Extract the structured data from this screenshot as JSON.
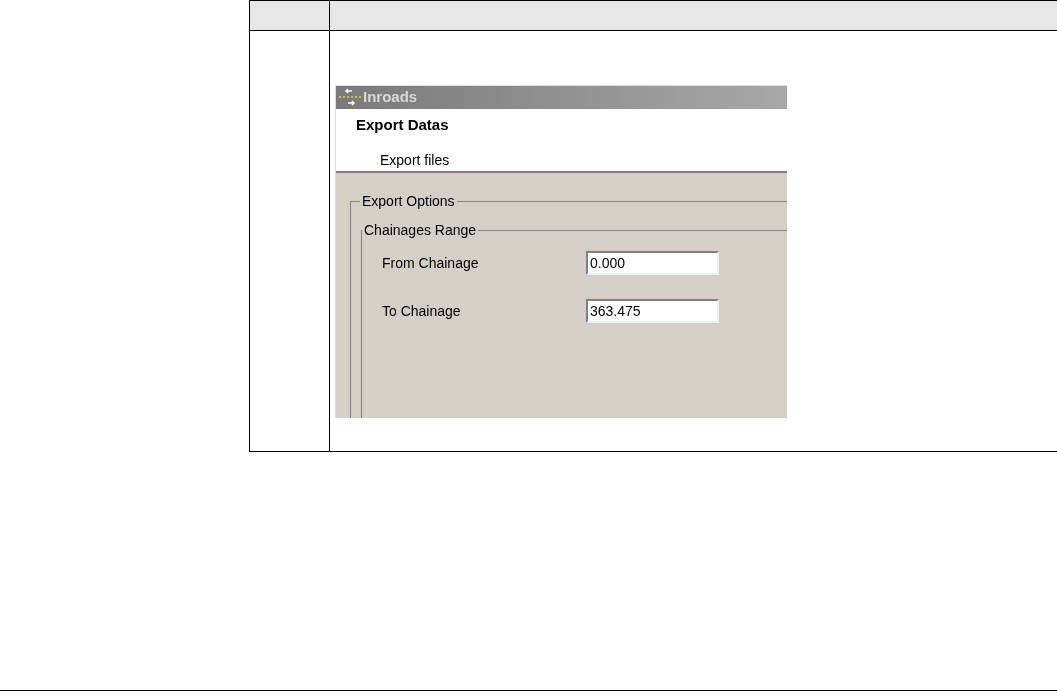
{
  "dialog": {
    "title": "Inroads",
    "heading": "Export Datas",
    "subheading": "Export files",
    "group": {
      "label": "Export Options",
      "subgroup": {
        "label": "Chainages Range",
        "fields": [
          {
            "label": "From Chainage",
            "value": "0.000"
          },
          {
            "label": "To Chainage",
            "value": "363.475"
          }
        ]
      }
    }
  }
}
